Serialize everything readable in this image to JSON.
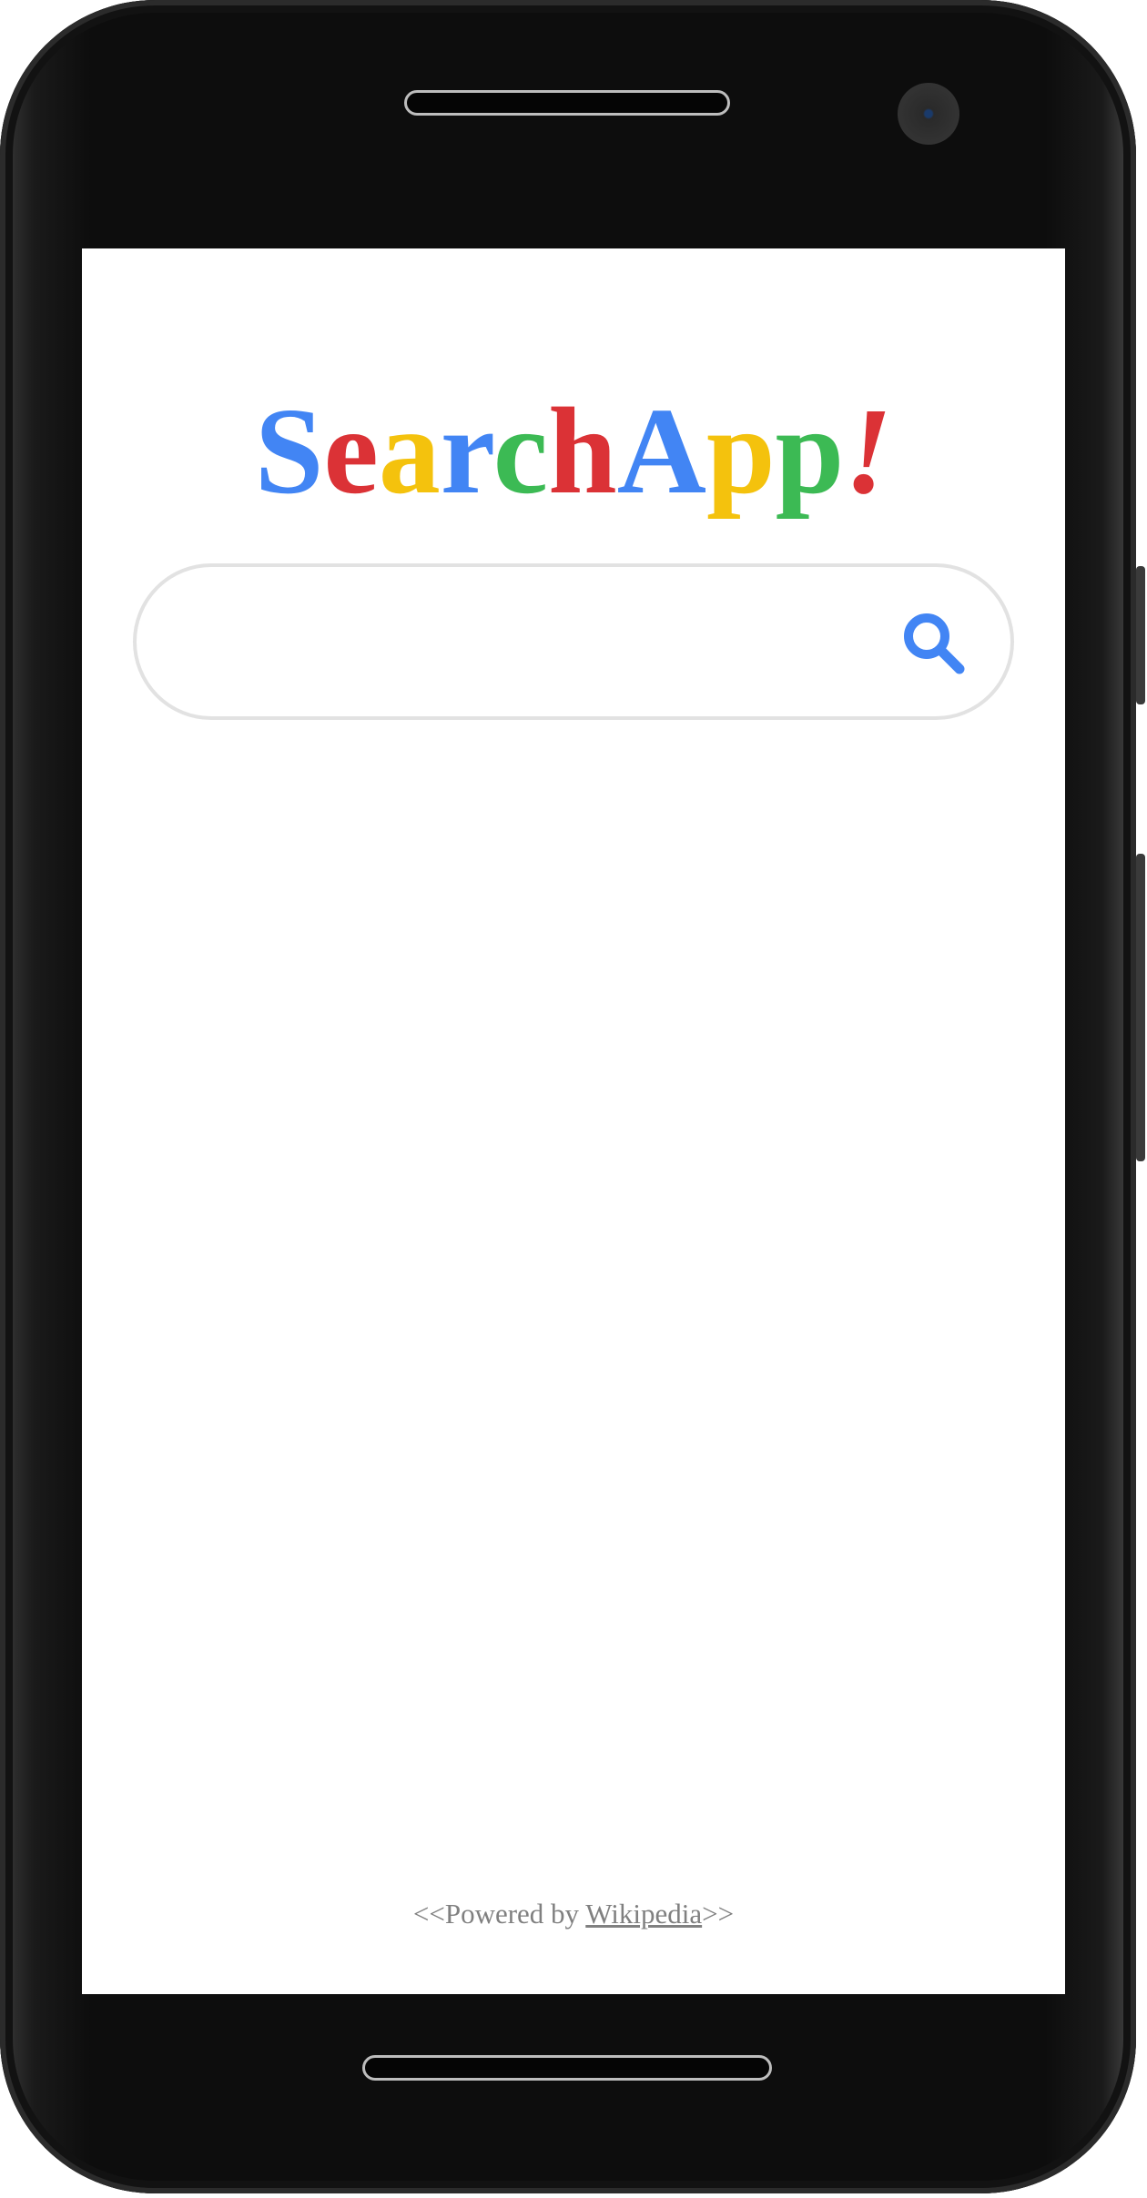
{
  "app": {
    "logo_letters": [
      {
        "char": "S",
        "color": "#4285F4"
      },
      {
        "char": "e",
        "color": "#DB3236"
      },
      {
        "char": "a",
        "color": "#F4C20D"
      },
      {
        "char": "r",
        "color": "#4285F4"
      },
      {
        "char": "c",
        "color": "#3CBA54"
      },
      {
        "char": "h",
        "color": "#DB3236"
      },
      {
        "char": "A",
        "color": "#4285F4"
      },
      {
        "char": "p",
        "color": "#F4C20D"
      },
      {
        "char": "p",
        "color": "#3CBA54"
      },
      {
        "char": "!",
        "color": "#DB3236"
      }
    ]
  },
  "search": {
    "value": "",
    "placeholder": "",
    "icon": "search-icon",
    "icon_color": "#4285F4"
  },
  "footer": {
    "prefix": "<<Powered by ",
    "link_text": "Wikipedia",
    "suffix": ">>"
  },
  "colors": {
    "phone_body": "#0d0d0d",
    "screen_bg": "#ffffff",
    "search_border": "#e2e2e2",
    "footer_text": "#808080"
  }
}
